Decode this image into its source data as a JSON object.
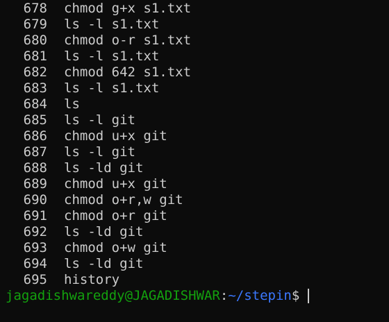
{
  "history": [
    {
      "num": "678",
      "cmd": "chmod g+x s1.txt"
    },
    {
      "num": "679",
      "cmd": "ls -l s1.txt"
    },
    {
      "num": "680",
      "cmd": "chmod o-r s1.txt"
    },
    {
      "num": "681",
      "cmd": "ls -l s1.txt"
    },
    {
      "num": "682",
      "cmd": "chmod 642 s1.txt"
    },
    {
      "num": "683",
      "cmd": "ls -l s1.txt"
    },
    {
      "num": "684",
      "cmd": "ls"
    },
    {
      "num": "685",
      "cmd": "ls -l git"
    },
    {
      "num": "686",
      "cmd": "chmod u+x git"
    },
    {
      "num": "687",
      "cmd": "ls -l git"
    },
    {
      "num": "688",
      "cmd": "ls -ld git"
    },
    {
      "num": "689",
      "cmd": "chmod u+x git"
    },
    {
      "num": "690",
      "cmd": "chmod o+r,w git"
    },
    {
      "num": "691",
      "cmd": "chmod o+r git"
    },
    {
      "num": "692",
      "cmd": "ls -ld git"
    },
    {
      "num": "693",
      "cmd": "chmod o+w git"
    },
    {
      "num": "694",
      "cmd": "ls -ld git"
    },
    {
      "num": "695",
      "cmd": "history"
    }
  ],
  "prompt": {
    "user_host": "jagadishwareddy@JAGADISHWAR",
    "colon": ":",
    "path": "~/stepin",
    "symbol": "$"
  },
  "colors": {
    "background": "#0c0c0c",
    "text": "#cccccc",
    "user_host": "#13a10e",
    "path": "#3b78ff"
  }
}
